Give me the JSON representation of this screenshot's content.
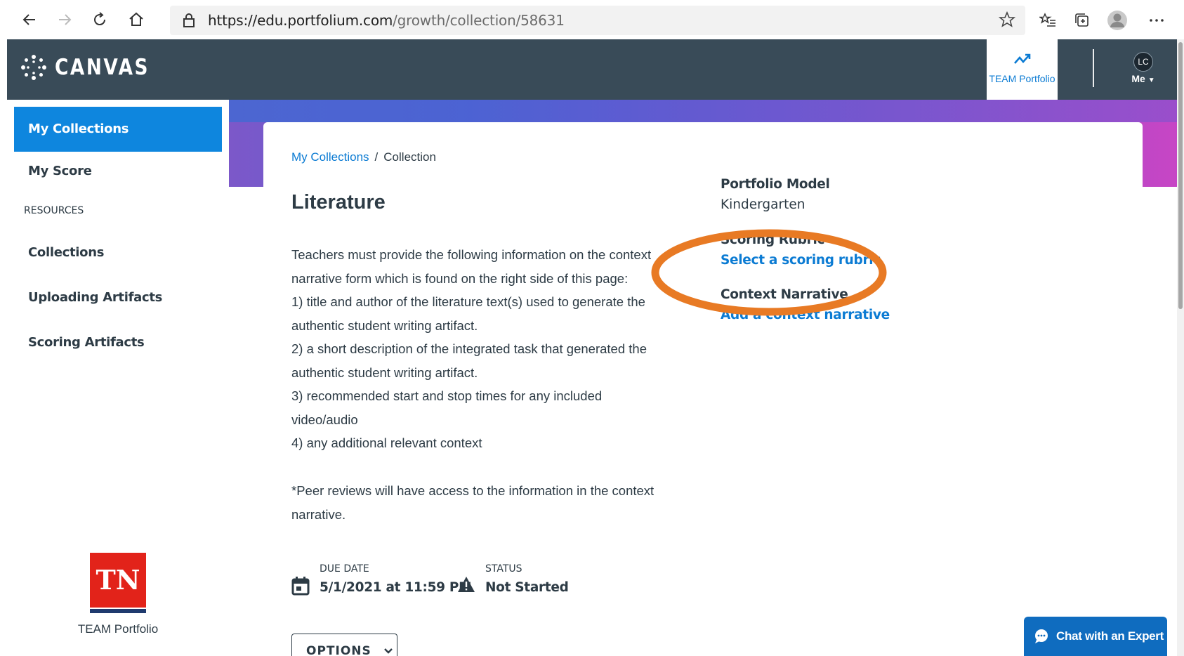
{
  "browser": {
    "url_host": "https://edu.portfolium.com",
    "url_path": "/growth/collection/58631",
    "icons": [
      "back-arrow-icon",
      "forward-arrow-icon",
      "refresh-icon",
      "home-icon",
      "lock-icon",
      "star-icon",
      "favorites-icon",
      "collections-icon",
      "profile-icon",
      "more-icon"
    ]
  },
  "header": {
    "logo_text": "CANVAS",
    "team_portfolio_label": "TEAM Portfolio",
    "avatar_initials": "LC",
    "me_label": "Me",
    "bg_color": "#394b58"
  },
  "sidebar": {
    "items": [
      {
        "label": "My Collections",
        "active": true
      },
      {
        "label": "My Score",
        "active": false
      }
    ],
    "resources_heading": "RESOURCES",
    "resource_items": [
      {
        "label": "Collections"
      },
      {
        "label": "Uploading Artifacts"
      },
      {
        "label": "Scoring Artifacts"
      }
    ],
    "footer_logo_text": "TN",
    "footer_caption": "TEAM Portfolio",
    "accent_color": "#0e86de"
  },
  "main": {
    "breadcrumb": {
      "link": "My Collections",
      "separator": "/",
      "current": "Collection"
    },
    "title": "Literature",
    "description_lines": [
      "Teachers must provide the following information on the context",
      "narrative form which is found on the right side of this page:",
      "1) title and author of the literature text(s) used to generate the",
      "authentic student writing artifact.",
      "2) a short description of the integrated task that generated the",
      "authentic student writing artifact.",
      "3) recommended start and stop times for any included",
      "video/audio",
      "4) any additional relevant context"
    ],
    "peer_note_lines": [
      "*Peer reviews will have access to the information in the context",
      "narrative."
    ],
    "due_date": {
      "label": "DUE DATE",
      "value": "5/1/2021 at 11:59 PM"
    },
    "status": {
      "label": "STATUS",
      "value": "Not Started"
    },
    "options_label": "OPTIONS",
    "portfolio_model": {
      "label": "Portfolio Model",
      "value": "Kindergarten"
    },
    "scoring_rubric": {
      "label": "Scoring Rubric",
      "link": "Select a scoring rubric"
    },
    "context_narrative": {
      "label": "Context Narrative",
      "link": "Add a context narrative"
    },
    "highlight_color": "#e87a24"
  },
  "chat": {
    "label": "Chat with an Expert"
  }
}
